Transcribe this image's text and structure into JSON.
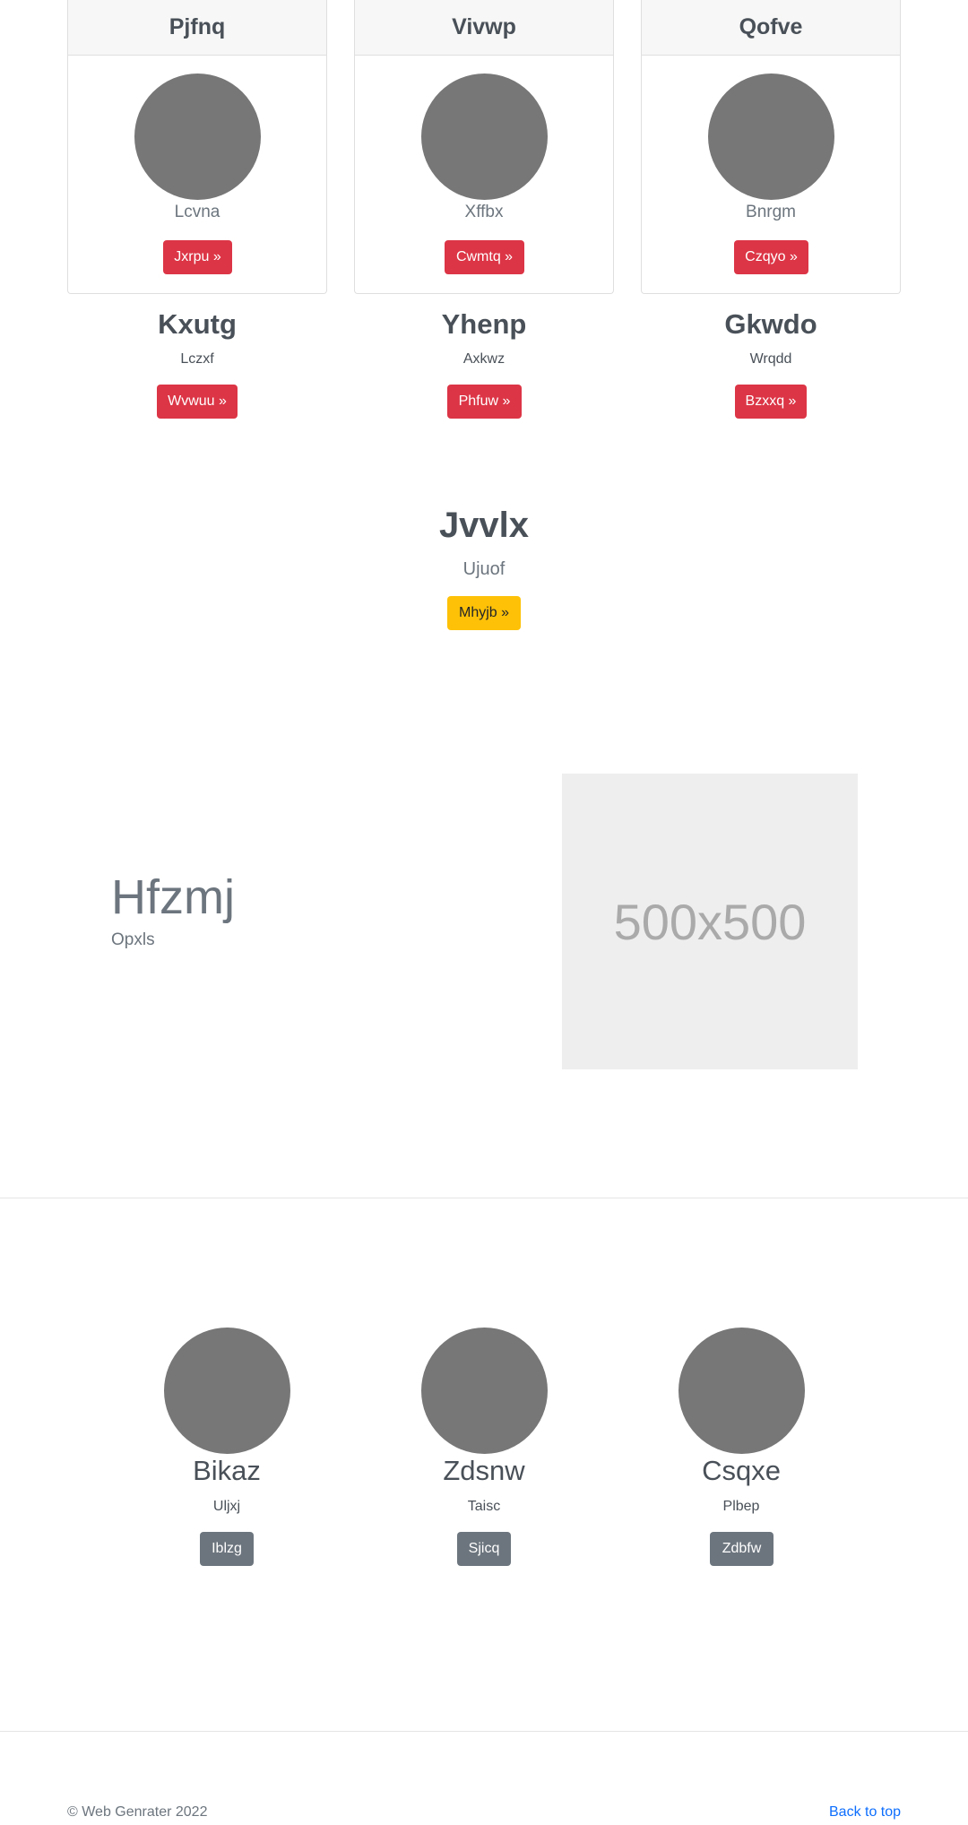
{
  "cards": [
    {
      "title": "Pjfnq",
      "subtitle": "Lcvna",
      "button": "Jxrpu »"
    },
    {
      "title": "Vivwp",
      "subtitle": "Xffbx",
      "button": "Cwmtq »"
    },
    {
      "title": "Qofve",
      "subtitle": "Bnrgm",
      "button": "Czqyo »"
    }
  ],
  "columns": [
    {
      "title": "Kxutg",
      "subtitle": "Lczxf",
      "button": "Wvwuu »"
    },
    {
      "title": "Yhenp",
      "subtitle": "Axkwz",
      "button": "Phfuw »"
    },
    {
      "title": "Gkwdo",
      "subtitle": "Wrqdd",
      "button": "Bzxxq »"
    }
  ],
  "hero": {
    "title": "Jvvlx",
    "subtitle": "Ujuof",
    "button": "Mhyjb »"
  },
  "feature": {
    "title": "Hfzmj",
    "subtitle": "Opxls",
    "image_label": "500x500"
  },
  "team": [
    {
      "name": "Bikaz",
      "role": "Uljxj",
      "button": "Iblzg"
    },
    {
      "name": "Zdsnw",
      "role": "Taisc",
      "button": "Sjicq"
    },
    {
      "name": "Csqxe",
      "role": "Plbep",
      "button": "Zdbfw"
    }
  ],
  "footer": {
    "copyright": "© Web Genrater 2022",
    "back_to_top": "Back to top"
  },
  "colors": {
    "danger": "#dc3545",
    "warning": "#ffc107",
    "secondary": "#6c757d",
    "link": "#0d6efd"
  }
}
